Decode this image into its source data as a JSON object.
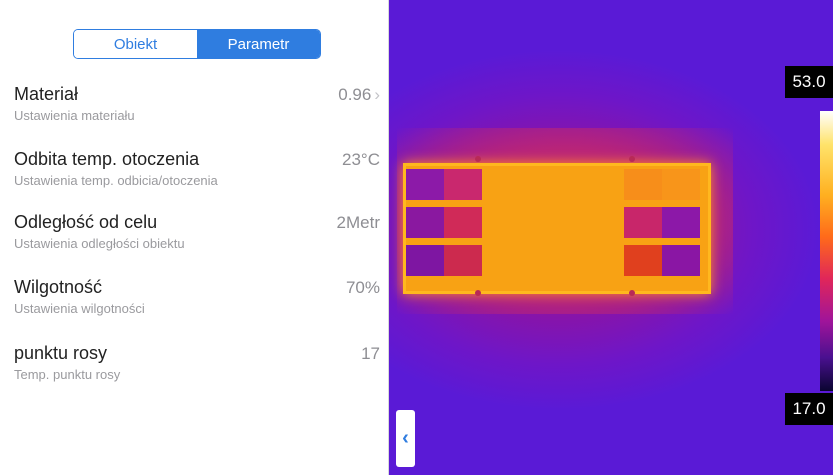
{
  "tabs": [
    {
      "label": "Obiekt",
      "active": false
    },
    {
      "label": "Parametr",
      "active": true
    }
  ],
  "settings": [
    {
      "title": "Materiał",
      "subtitle": "Ustawienia materiału",
      "value": "0.96",
      "chevron": true
    },
    {
      "title": "Odbita temp. otoczenia",
      "subtitle": "Ustawienia temp. odbicia/otoczenia",
      "value": "23°C",
      "chevron": false
    },
    {
      "title": "Odległość od celu",
      "subtitle": "Ustawienia odległości obiektu",
      "value": "2Metr",
      "chevron": false
    },
    {
      "title": "Wilgotność",
      "subtitle": "Ustawienia wilgotności",
      "value": "70%",
      "chevron": false
    },
    {
      "title": "punktu rosy",
      "subtitle": "Temp. punktu rosy",
      "value": "17",
      "chevron": false
    }
  ],
  "scale": {
    "max": "53.0",
    "min": "17.0"
  },
  "icons": {
    "chevron": "›",
    "back": "‹"
  },
  "colors": {
    "accent": "#2f7de0"
  }
}
